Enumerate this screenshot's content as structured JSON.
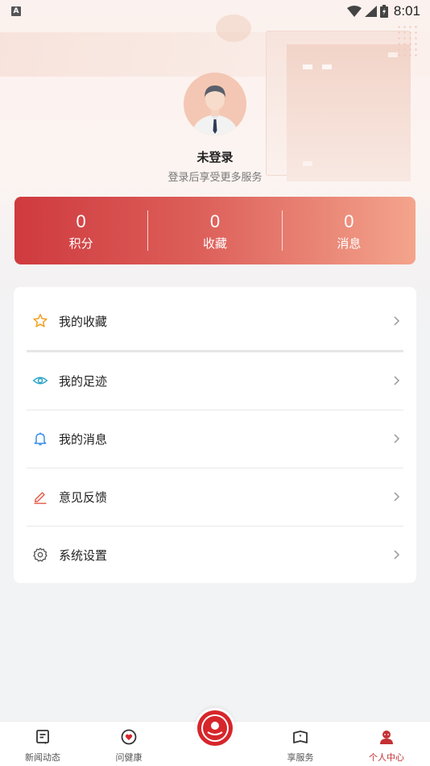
{
  "status_bar": {
    "badge": "A",
    "time": "8:01"
  },
  "profile": {
    "name": "未登录",
    "subtitle": "登录后享受更多服务"
  },
  "stats": [
    {
      "value": "0",
      "label": "积分"
    },
    {
      "value": "0",
      "label": "收藏"
    },
    {
      "value": "0",
      "label": "消息"
    }
  ],
  "menu": [
    {
      "label": "我的收藏",
      "icon": "star-icon"
    },
    {
      "label": "我的足迹",
      "icon": "eye-icon"
    },
    {
      "label": "我的消息",
      "icon": "bell-icon"
    },
    {
      "label": "意见反馈",
      "icon": "pencil-icon"
    },
    {
      "label": "系统设置",
      "icon": "gear-icon"
    }
  ],
  "tabs": [
    {
      "label": "新闻动态",
      "icon": "news-icon"
    },
    {
      "label": "问健康",
      "icon": "heart-icon"
    },
    {
      "label": "享服务",
      "icon": "book-icon"
    },
    {
      "label": "个人中心",
      "icon": "person-icon"
    }
  ],
  "colors": {
    "accent": "#c43034",
    "stats_start": "#cf3a3e",
    "stats_end": "#f4a48c"
  }
}
